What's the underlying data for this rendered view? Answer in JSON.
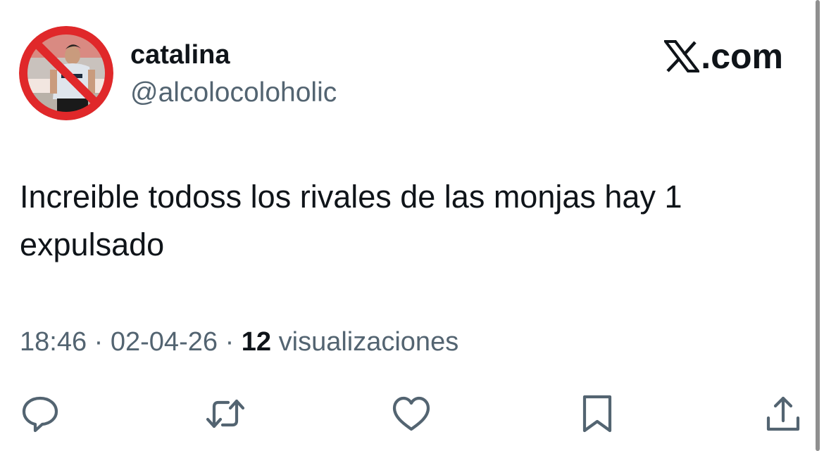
{
  "user": {
    "display_name": "catalina",
    "handle": "@alcolocoloholic",
    "avatar_icon": "avatar-prohibited-player"
  },
  "brand": {
    "label": ".com",
    "icon": "x-logo-icon"
  },
  "tweet": {
    "line1": "Increible todoss los rivales de las monjas hay 1",
    "line2": "expulsado"
  },
  "meta": {
    "time": "18:46",
    "sep1": "·",
    "date": "02-04-26",
    "sep2": "·",
    "views_count": "12",
    "views_label": "visualizaciones"
  },
  "actions": [
    "reply-icon",
    "retweet-icon",
    "like-icon",
    "bookmark-icon",
    "share-icon"
  ],
  "colors": {
    "text": "#0f1419",
    "secondary": "#536471",
    "prohibition_red": "#e0282a"
  }
}
